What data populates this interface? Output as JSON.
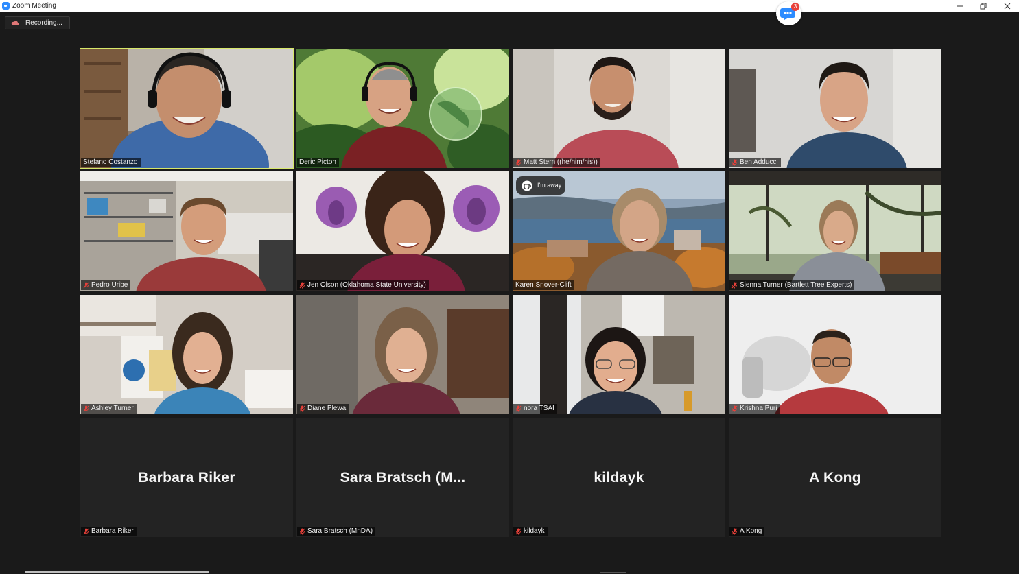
{
  "window": {
    "title": "Zoom Meeting",
    "controls": [
      "minimize",
      "restore",
      "close"
    ]
  },
  "recording": {
    "label": "Recording..."
  },
  "chat": {
    "icon": "chat-icon",
    "badge_count": "3"
  },
  "away_status": {
    "text": "I'm away",
    "icon": "coffee-icon"
  },
  "participants": [
    {
      "name": "Stefano Costanzo",
      "muted": false,
      "active_speaker": true,
      "video": true
    },
    {
      "name": "Deric Picton",
      "muted": false,
      "active_speaker": false,
      "video": true
    },
    {
      "name": "Matt Stern ((he/him/his))",
      "muted": true,
      "active_speaker": false,
      "video": true
    },
    {
      "name": "Ben Adducci",
      "muted": true,
      "active_speaker": false,
      "video": true
    },
    {
      "name": "Pedro Uribe",
      "muted": true,
      "active_speaker": false,
      "video": true
    },
    {
      "name": "Jen Olson (Oklahoma State University)",
      "muted": true,
      "active_speaker": false,
      "video": true
    },
    {
      "name": "Karen Snover-Clift",
      "muted": false,
      "active_speaker": false,
      "video": true
    },
    {
      "name": "Sienna Turner (Bartlett Tree Experts)",
      "muted": true,
      "active_speaker": false,
      "video": true
    },
    {
      "name": "Ashley Turner",
      "muted": true,
      "active_speaker": false,
      "video": true
    },
    {
      "name": "Diane Plewa",
      "muted": true,
      "active_speaker": false,
      "video": true
    },
    {
      "name": "nora TSAI",
      "muted": true,
      "active_speaker": false,
      "video": true
    },
    {
      "name": "Krishna Puri",
      "muted": true,
      "active_speaker": false,
      "video": true
    },
    {
      "name": "Barbara Riker",
      "display_name": "Barbara Riker",
      "muted": true,
      "active_speaker": false,
      "video": false
    },
    {
      "name": "Sara Bratsch (MnDA)",
      "display_name": "Sara Bratsch (M...",
      "muted": true,
      "active_speaker": false,
      "video": false
    },
    {
      "name": "kildayk",
      "display_name": "kildayk",
      "muted": true,
      "active_speaker": false,
      "video": false
    },
    {
      "name": "A Kong",
      "display_name": "A Kong",
      "muted": true,
      "active_speaker": false,
      "video": false
    }
  ],
  "colors": {
    "background": "#1a1a1a",
    "tile_background": "#232323",
    "active_speaker_border": "#d7e86a",
    "mute_icon": "#e8413a",
    "badge": "#e8413a"
  }
}
